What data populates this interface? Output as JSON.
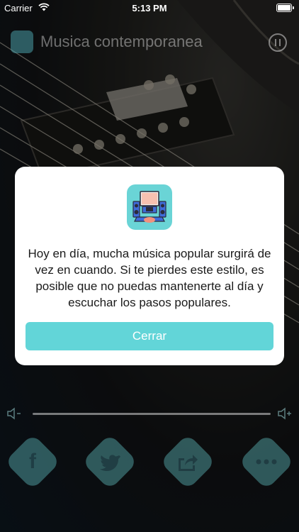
{
  "status_bar": {
    "carrier": "Carrier",
    "time": "5:13 PM"
  },
  "header": {
    "title": "Musica contemporanea",
    "app_icon": "studio-mixer-icon",
    "pause_icon": "pause-icon"
  },
  "modal": {
    "icon": "studio-mixer-icon",
    "message": "Hoy en día, mucha música popular surgirá de vez en cuando. Si te pierdes este estilo, es posible que no puedas mantenerte al día y escuchar los pasos populares.",
    "button_label": "Cerrar"
  },
  "player": {
    "volume_low_icon": "volume-low-icon",
    "volume_high_icon": "volume-high-icon"
  },
  "share": [
    {
      "icon": "facebook-icon"
    },
    {
      "icon": "twitter-icon"
    },
    {
      "icon": "share-icon"
    },
    {
      "icon": "more-icon"
    }
  ],
  "colors": {
    "accent": "#62d5d8",
    "modal_bg": "#ffffff",
    "text": "#1a1a1a"
  }
}
